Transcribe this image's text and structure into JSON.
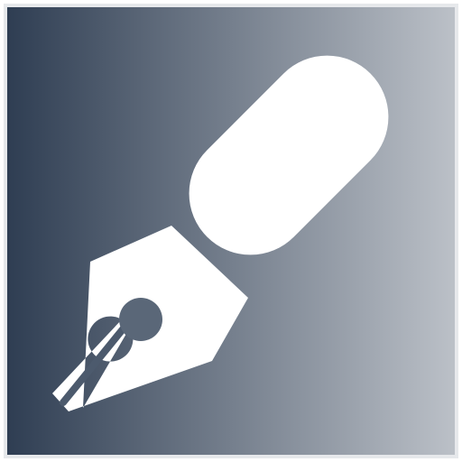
{
  "icon": {
    "name": "fountain-pen-icon",
    "description_visible_text": "",
    "colors": {
      "gradient_left": "#2e3d52",
      "gradient_right": "#bcc1c8",
      "border": "#e6e8eb",
      "pen": "#ffffff"
    }
  }
}
